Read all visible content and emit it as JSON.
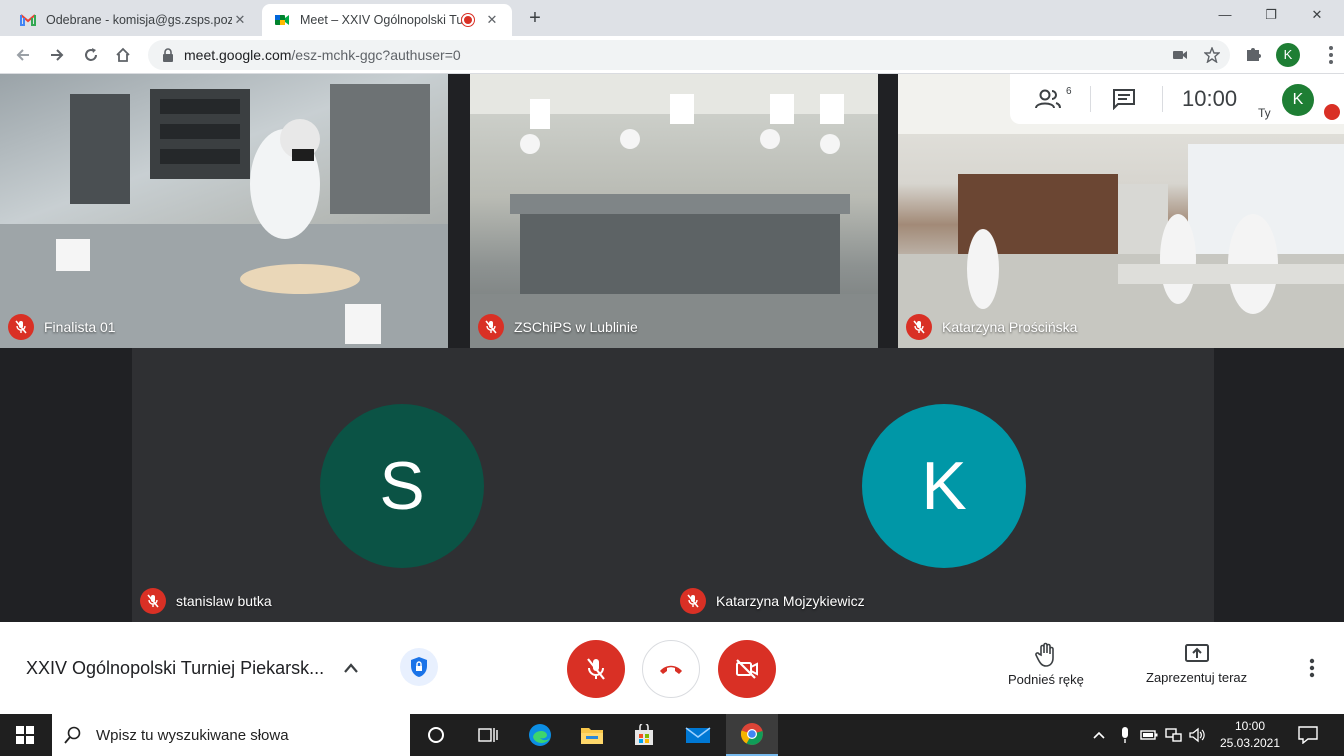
{
  "browser": {
    "tabs": [
      {
        "title": "Odebrane - komisja@gs.zsps.poz",
        "favicon": "gmail-icon",
        "active": false
      },
      {
        "title": "Meet – XXIV Ogólnopolski Tu",
        "favicon": "meet-icon",
        "active": true,
        "recording": true
      }
    ],
    "new_tab": "+",
    "url": {
      "host": "meet.google.com",
      "path": "/esz-mchk-ggc?authuser=0"
    },
    "profile_initial": "K",
    "window_controls": {
      "minimize": "—",
      "restore": "❐",
      "close": "✕"
    }
  },
  "meet": {
    "participants_count": "6",
    "clock": "10:00",
    "self_label": "Ty",
    "self_initial": "K",
    "tiles": [
      {
        "name": "Finalista 01",
        "muted": true,
        "kind": "video"
      },
      {
        "name": "ZSChiPS w Lublinie",
        "muted": true,
        "kind": "video"
      },
      {
        "name": "Katarzyna Prościńska",
        "muted": true,
        "kind": "video"
      },
      {
        "name": "stanislaw butka",
        "muted": true,
        "kind": "avatar",
        "initial": "S",
        "color": "#0b5345"
      },
      {
        "name": "Katarzyna Mojzykiewicz",
        "muted": true,
        "kind": "avatar",
        "initial": "K",
        "color": "#0097a7"
      }
    ],
    "meeting_title": "XXIV Ogólnopolski Turniej Piekarsk...",
    "actions": {
      "raise_hand": "Podnieś rękę",
      "present": "Zaprezentuj teraz"
    }
  },
  "taskbar": {
    "search_placeholder": "Wpisz tu wyszukiwane słowa",
    "time": "10:00",
    "date": "25.03.2021"
  },
  "colors": {
    "accent_red": "#d93025",
    "taskbar": "#1f1f1f",
    "meet_bg": "#202124"
  }
}
